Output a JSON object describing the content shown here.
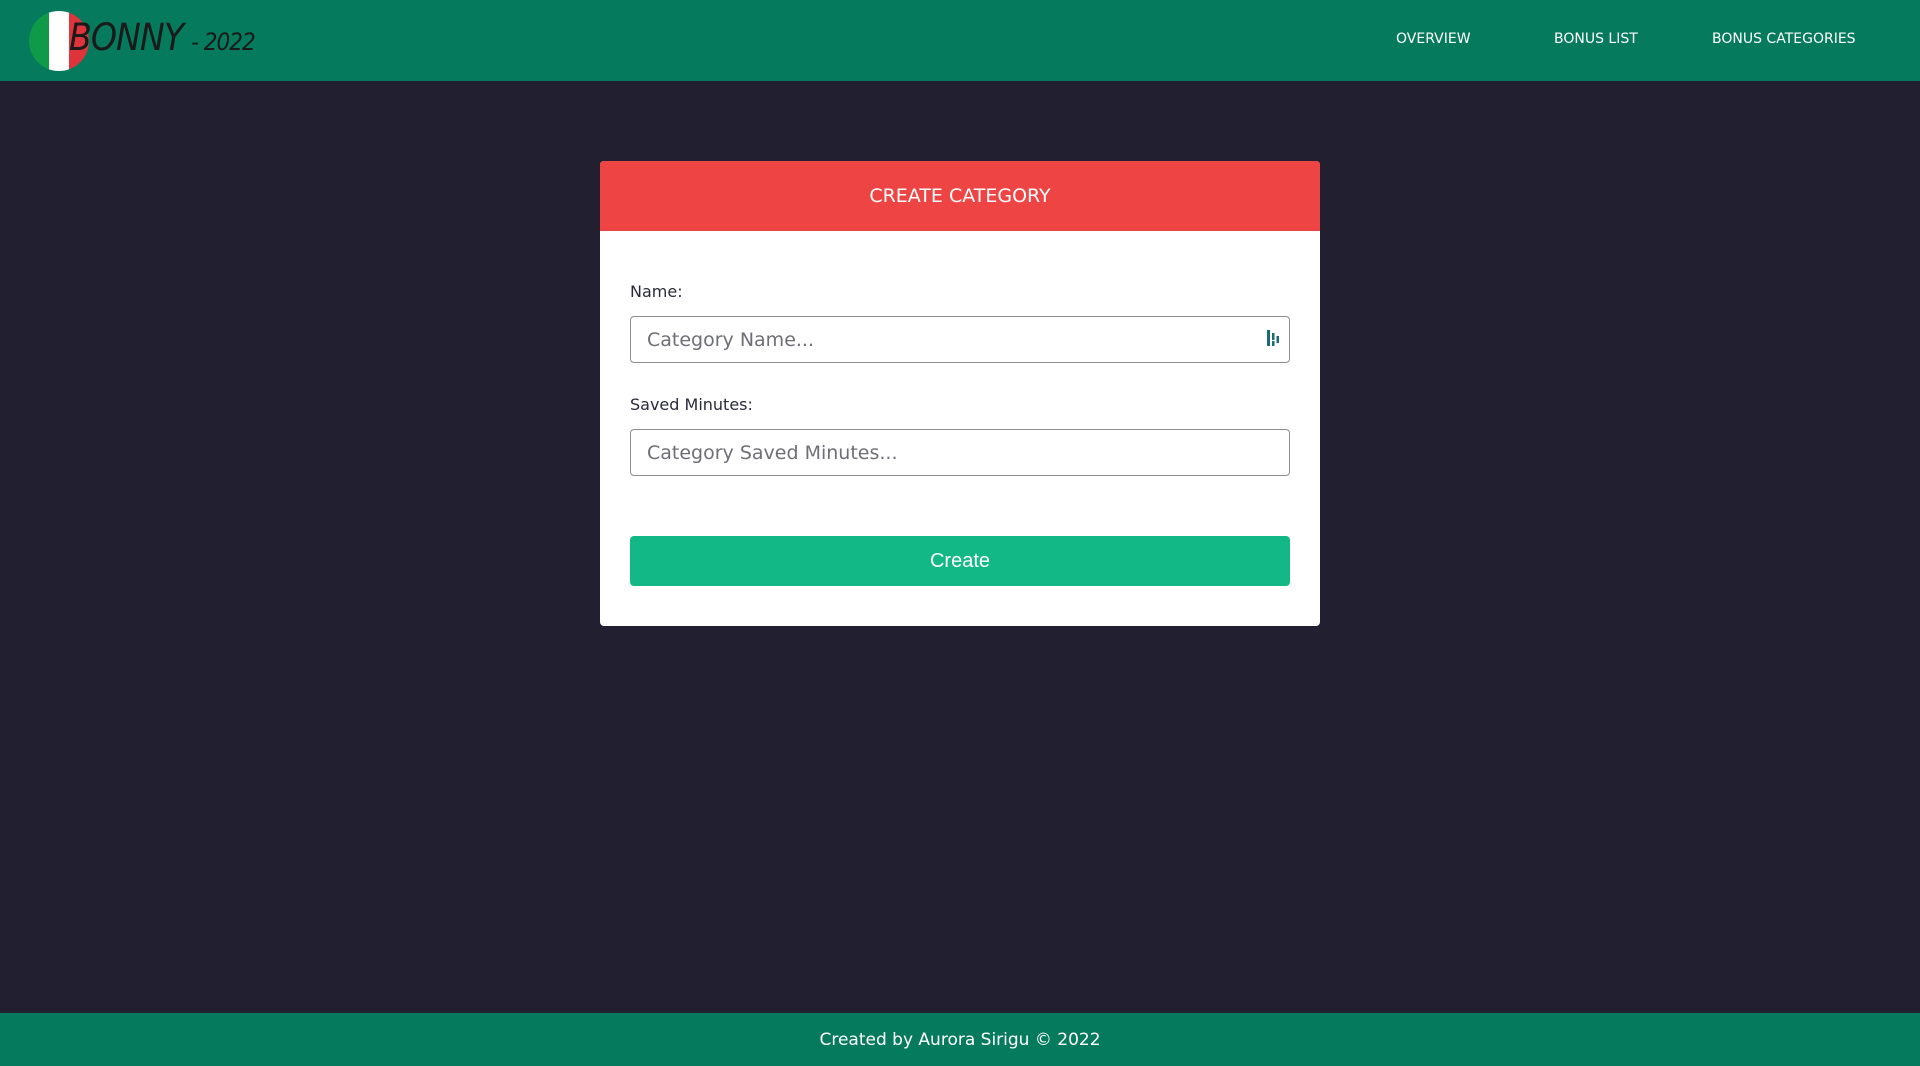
{
  "header": {
    "logo_text": "BONNY",
    "logo_year": "- 2022",
    "nav": [
      {
        "label": "OVERVIEW"
      },
      {
        "label": "BONUS LIST"
      },
      {
        "label": "BONUS CATEGORIES"
      }
    ]
  },
  "form": {
    "title": "CREATE CATEGORY",
    "name_label": "Name:",
    "name_placeholder": "Category Name...",
    "minutes_label": "Saved Minutes:",
    "minutes_placeholder": "Category Saved Minutes...",
    "submit_label": "Create"
  },
  "footer": {
    "text": "Created by Aurora Sirigu © 2022"
  },
  "colors": {
    "header_bg": "#067a5c",
    "page_bg": "#211f30",
    "card_header": "#ef4444",
    "button": "#12b886"
  },
  "icons": {
    "logo": "italy-flag-icon",
    "name_field": "password-manager-icon"
  }
}
